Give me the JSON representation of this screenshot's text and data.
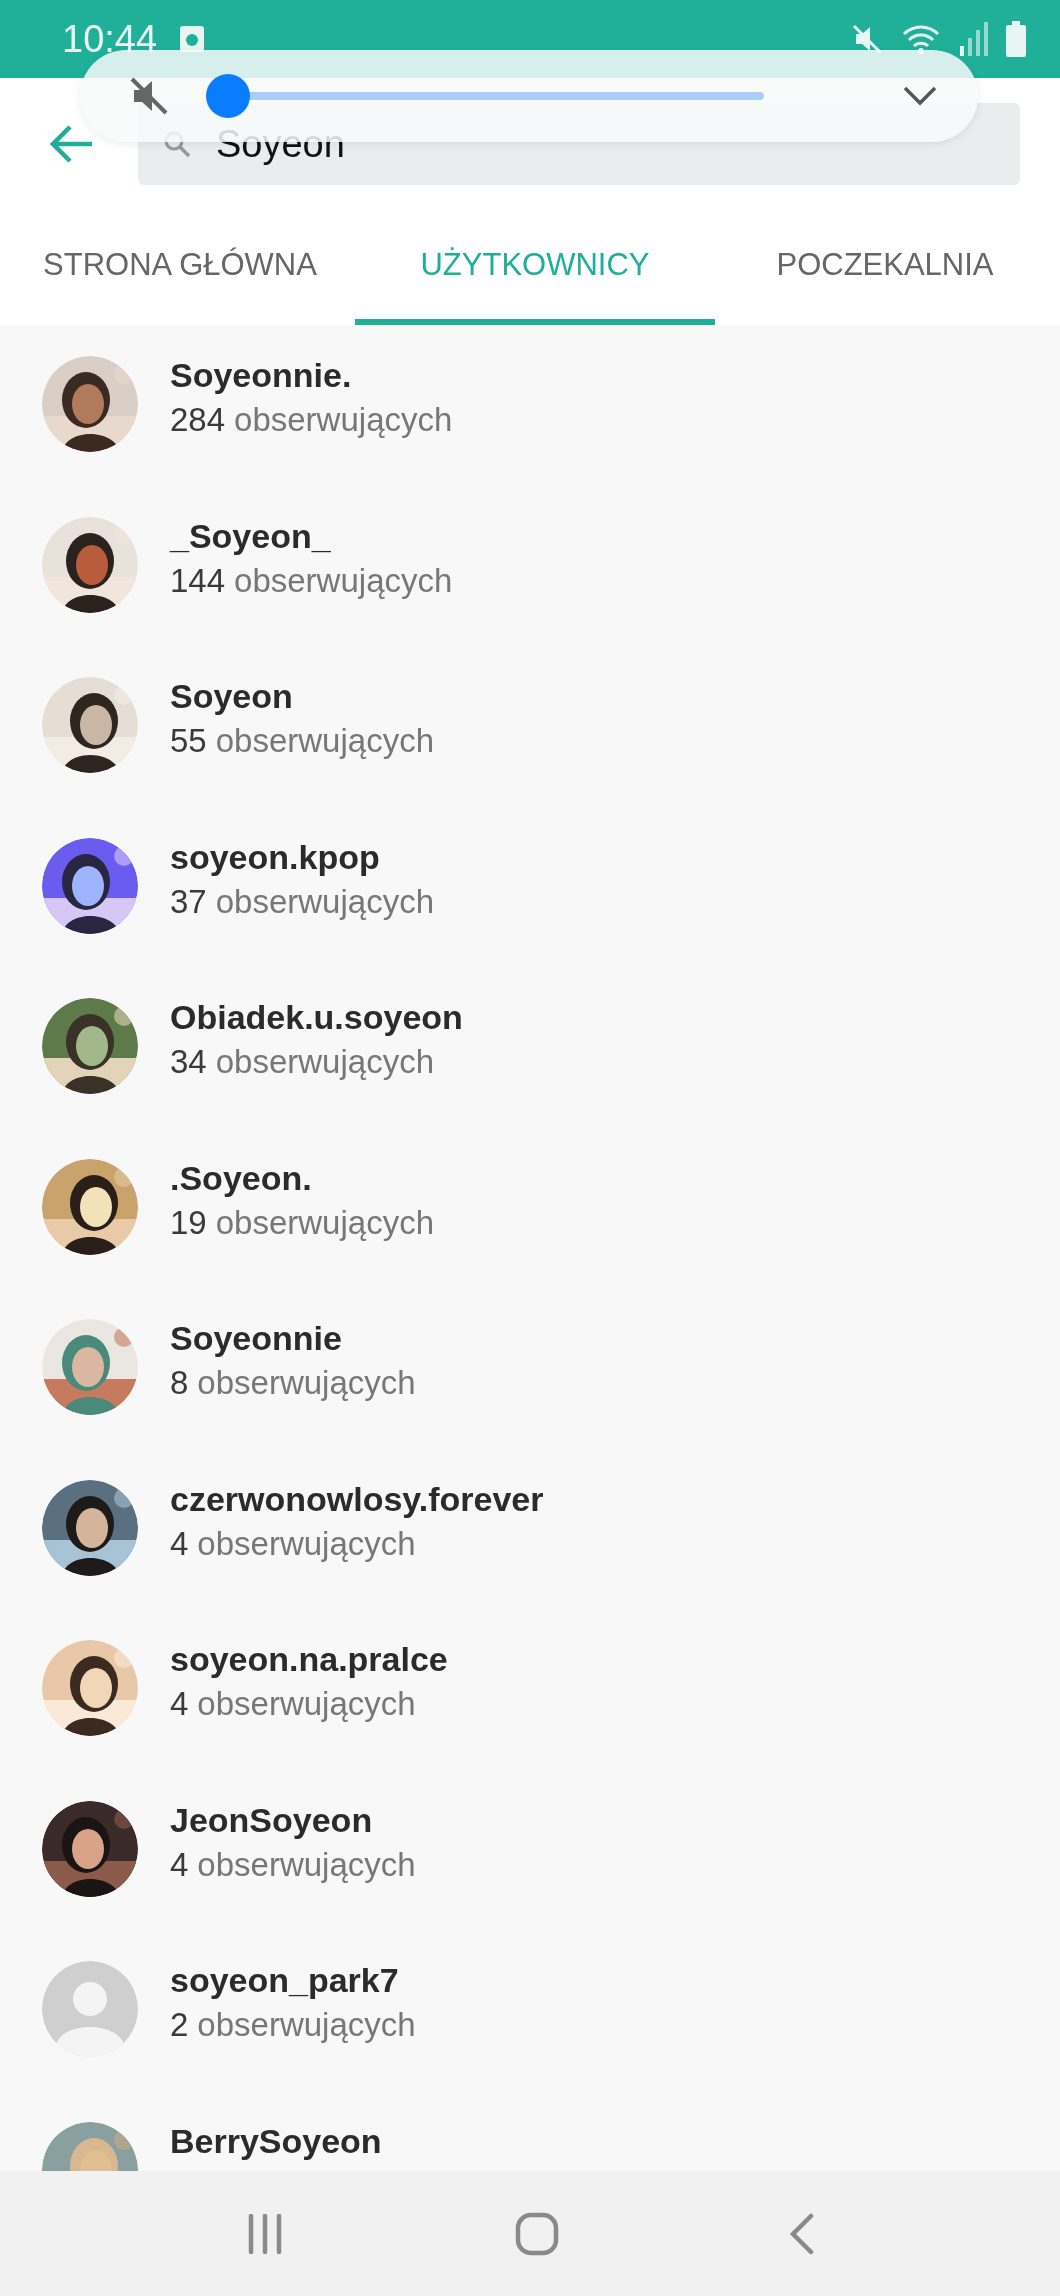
{
  "status_bar": {
    "time": "10:44"
  },
  "volume_panel": {
    "level": 0
  },
  "search": {
    "value": "Soyeon"
  },
  "tabs": [
    {
      "label": "STRONA GŁÓWNA",
      "selected": false
    },
    {
      "label": "UŻYTKOWNICY",
      "selected": true
    },
    {
      "label": "POCZEKALNIA",
      "selected": false
    }
  ],
  "users": [
    {
      "name": "Soyeonnie.",
      "followers": "284",
      "followers_label": "obserwujących",
      "kind": "picture"
    },
    {
      "name": "_Soyeon_",
      "followers": "144",
      "followers_label": "obserwujących",
      "kind": "picture"
    },
    {
      "name": "Soyeon",
      "followers": "55",
      "followers_label": "obserwujących",
      "kind": "picture"
    },
    {
      "name": "soyeon.kpop",
      "followers": "37",
      "followers_label": "obserwujących",
      "kind": "picture"
    },
    {
      "name": "Obiadek.u.soyeon",
      "followers": "34",
      "followers_label": "obserwujących",
      "kind": "picture"
    },
    {
      "name": ".Soyeon.",
      "followers": "19",
      "followers_label": "obserwujących",
      "kind": "picture"
    },
    {
      "name": "Soyeonnie",
      "followers": "8",
      "followers_label": "obserwujących",
      "kind": "picture"
    },
    {
      "name": "czerwonowlosy.forever",
      "followers": "4",
      "followers_label": "obserwujących",
      "kind": "picture"
    },
    {
      "name": "soyeon.na.pralce",
      "followers": "4",
      "followers_label": "obserwujących",
      "kind": "picture"
    },
    {
      "name": "JeonSoyeon",
      "followers": "4",
      "followers_label": "obserwujących",
      "kind": "picture"
    },
    {
      "name": "soyeon_park7",
      "followers": "2",
      "followers_label": "obserwujących",
      "kind": "default"
    },
    {
      "name": "BerrySoyeon",
      "kind": "picture"
    }
  ]
}
